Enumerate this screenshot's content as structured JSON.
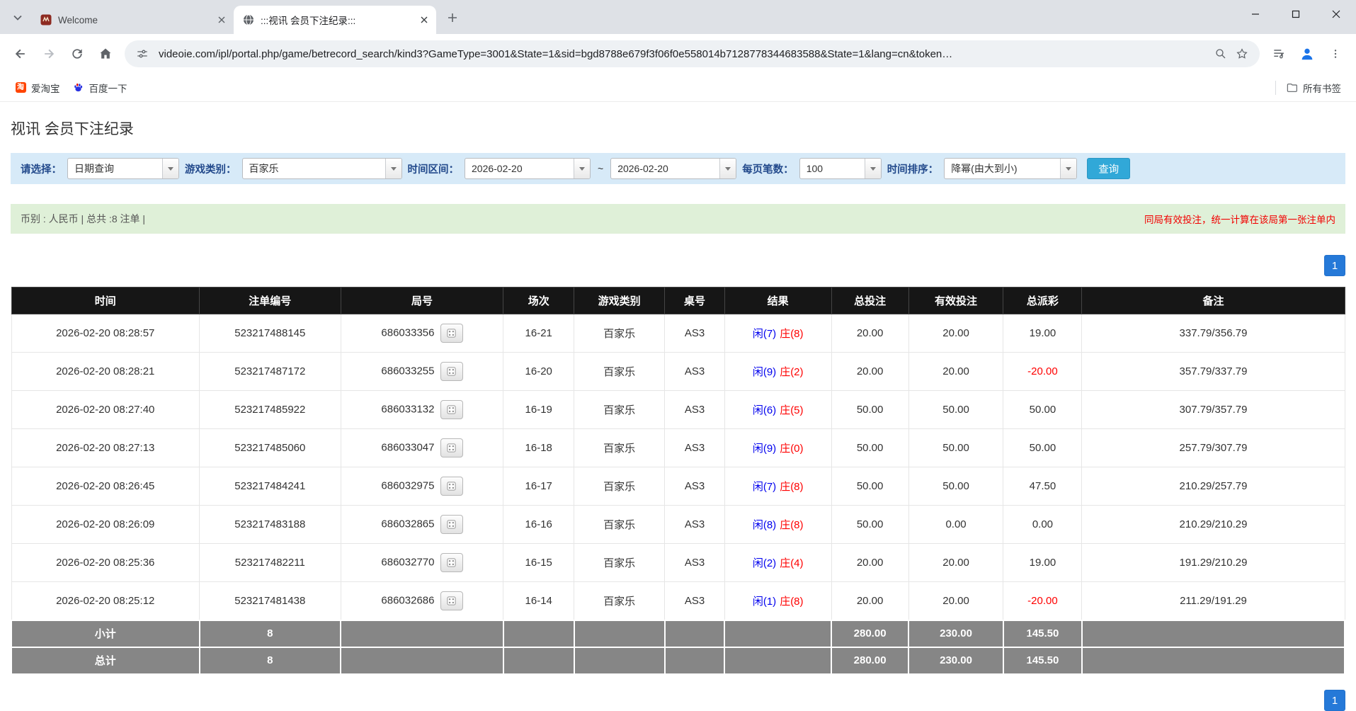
{
  "browser": {
    "tabs": [
      {
        "title": "Welcome"
      },
      {
        "title": ":::视讯 会员下注纪录:::"
      }
    ],
    "url": "videoie.com/ipl/portal.php/game/betrecord_search/kind3?GameType=3001&State=1&sid=bgd8788e679f3f06f0e558014b7128778344683588&State=1&lang=cn&token…",
    "bookmarks": [
      {
        "label": "爱淘宝"
      },
      {
        "label": "百度一下"
      }
    ],
    "all_bookmarks_label": "所有书签",
    "taobao_icon_char": "淘"
  },
  "page": {
    "title": "视讯 会员下注纪录",
    "filters": {
      "select_label": "请选择：",
      "select_value": "日期查询",
      "game_type_label": "游戏类别：",
      "game_type_value": "百家乐",
      "range_label": "时间区间：",
      "date_from": "2026-02-20",
      "range_separator": "~",
      "date_to": "2026-02-20",
      "page_size_label": "每页笔数：",
      "page_size_value": "100",
      "sort_label": "时间排序：",
      "sort_value": "降幂(由大到小)",
      "search_button": "查询"
    },
    "summary_left": "币别 : 人民币 | 总共 :8 注单 |",
    "summary_right": "同局有效投注，统一计算在该局第一张注单内",
    "pagination_page": "1"
  },
  "colors": {
    "header_bg": "#161616",
    "footer_bg": "#868686",
    "link_blue": "#0066cc",
    "player_blue": "#0000ee",
    "banker_red": "#ff0000",
    "negative_red": "#ff0000",
    "filter_bg": "#d7eaf8",
    "summary_bg": "#dff0d8",
    "search_button_cyan": "#31a8d8",
    "pagination_blue": "#2579d8"
  },
  "table": {
    "headers": [
      "时间",
      "注单编号",
      "局号",
      "场次",
      "游戏类别",
      "桌号",
      "结果",
      "总投注",
      "有效投注",
      "总派彩",
      "备注"
    ],
    "rows": [
      {
        "time": "2026-02-20 08:28:57",
        "bet_id": "523217488145",
        "round_id": "686033356",
        "session": "16-21",
        "game": "百家乐",
        "table_no": "AS3",
        "result_player": "闲(7)",
        "result_banker": "庄(8)",
        "total_bet": "20.00",
        "valid_bet": "20.00",
        "payout": "19.00",
        "note": "337.79/356.79"
      },
      {
        "time": "2026-02-20 08:28:21",
        "bet_id": "523217487172",
        "round_id": "686033255",
        "session": "16-20",
        "game": "百家乐",
        "table_no": "AS3",
        "result_player": "闲(9)",
        "result_banker": "庄(2)",
        "total_bet": "20.00",
        "valid_bet": "20.00",
        "payout": "-20.00",
        "note": "357.79/337.79"
      },
      {
        "time": "2026-02-20 08:27:40",
        "bet_id": "523217485922",
        "round_id": "686033132",
        "session": "16-19",
        "game": "百家乐",
        "table_no": "AS3",
        "result_player": "闲(6)",
        "result_banker": "庄(5)",
        "total_bet": "50.00",
        "valid_bet": "50.00",
        "payout": "50.00",
        "note": "307.79/357.79"
      },
      {
        "time": "2026-02-20 08:27:13",
        "bet_id": "523217485060",
        "round_id": "686033047",
        "session": "16-18",
        "game": "百家乐",
        "table_no": "AS3",
        "result_player": "闲(9)",
        "result_banker": "庄(0)",
        "total_bet": "50.00",
        "valid_bet": "50.00",
        "payout": "50.00",
        "note": "257.79/307.79"
      },
      {
        "time": "2026-02-20 08:26:45",
        "bet_id": "523217484241",
        "round_id": "686032975",
        "session": "16-17",
        "game": "百家乐",
        "table_no": "AS3",
        "result_player": "闲(7)",
        "result_banker": "庄(8)",
        "total_bet": "50.00",
        "valid_bet": "50.00",
        "payout": "47.50",
        "note": "210.29/257.79"
      },
      {
        "time": "2026-02-20 08:26:09",
        "bet_id": "523217483188",
        "round_id": "686032865",
        "session": "16-16",
        "game": "百家乐",
        "table_no": "AS3",
        "result_player": "闲(8)",
        "result_banker": "庄(8)",
        "total_bet": "50.00",
        "valid_bet": "0.00",
        "payout": "0.00",
        "note": "210.29/210.29"
      },
      {
        "time": "2026-02-20 08:25:36",
        "bet_id": "523217482211",
        "round_id": "686032770",
        "session": "16-15",
        "game": "百家乐",
        "table_no": "AS3",
        "result_player": "闲(2)",
        "result_banker": "庄(4)",
        "total_bet": "20.00",
        "valid_bet": "20.00",
        "payout": "19.00",
        "note": "191.29/210.29"
      },
      {
        "time": "2026-02-20 08:25:12",
        "bet_id": "523217481438",
        "round_id": "686032686",
        "session": "16-14",
        "game": "百家乐",
        "table_no": "AS3",
        "result_player": "闲(1)",
        "result_banker": "庄(8)",
        "total_bet": "20.00",
        "valid_bet": "20.00",
        "payout": "-20.00",
        "note": "211.29/191.29"
      }
    ],
    "subtotal": {
      "label": "小计",
      "count": "8",
      "total_bet": "280.00",
      "valid_bet": "230.00",
      "payout": "145.50"
    },
    "total": {
      "label": "总计",
      "count": "8",
      "total_bet": "280.00",
      "valid_bet": "230.00",
      "payout": "145.50"
    }
  }
}
